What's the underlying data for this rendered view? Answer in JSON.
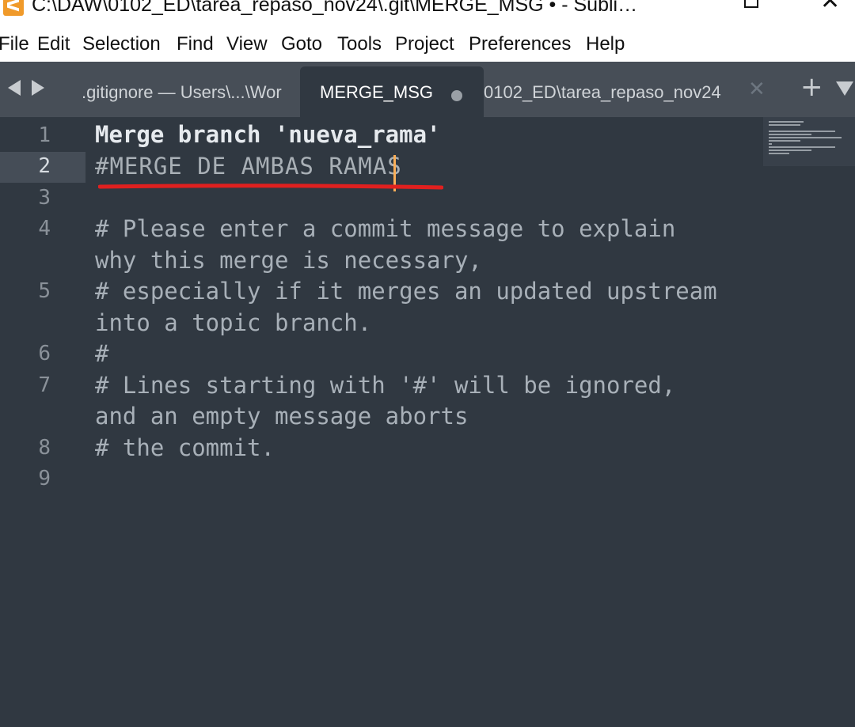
{
  "window": {
    "title": "C:\\DAW\\0102_ED\\tarea_repaso_nov24\\.git\\MERGE_MSG • - Subli…",
    "close_glyph": "✕"
  },
  "menu": [
    "File",
    "Edit",
    "Selection",
    "Find",
    "View",
    "Goto",
    "Tools",
    "Project",
    "Preferences",
    "Help"
  ],
  "tabs": [
    {
      "label": ".gitignore — Users\\...\\Wor"
    },
    {
      "label": "MERGE_MSG",
      "active": true,
      "modified": true
    },
    {
      "label": "0102_ED\\tarea_repaso_nov24"
    }
  ],
  "tabbar": {
    "close_glyph": "✕",
    "add_glyph": "+"
  },
  "editor": {
    "active_line": 2,
    "line_numbers": [
      "1",
      "2",
      "3",
      "4",
      "5",
      "6",
      "7",
      "8",
      "9"
    ],
    "visual_lines": [
      "Merge branch 'nueva_rama'",
      "#MERGE DE AMBAS RAMAS",
      "",
      "# Please enter a commit message to explain",
      "why this merge is necessary,",
      "# especially if it merges an updated upstream",
      "into a topic branch.",
      "#",
      "# Lines starting with '#' will be ignored,",
      "and an empty message aborts",
      "# the commit.",
      ""
    ]
  },
  "colors": {
    "editor_bg": "#303841",
    "tabbar_bg": "#474e57",
    "cursor": "#f9ae58",
    "annotation": "#e0201f"
  }
}
